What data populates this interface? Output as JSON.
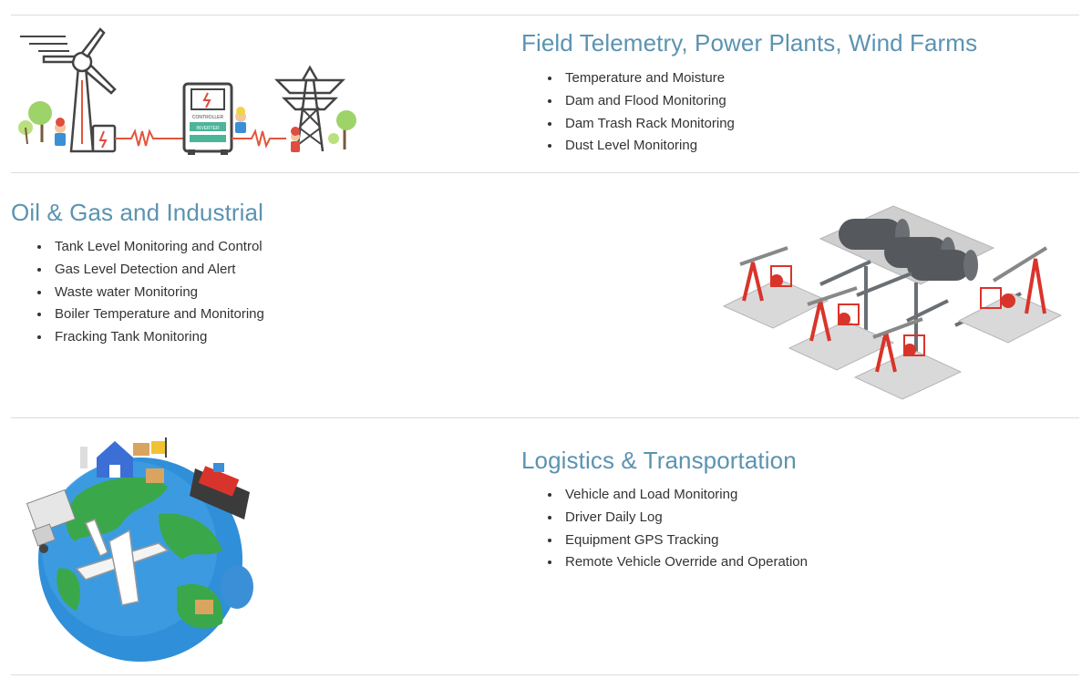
{
  "sections": [
    {
      "title": "Field Telemetry, Power Plants, Wind Farms",
      "items": [
        "Temperature and Moisture",
        "Dam and Flood Monitoring",
        "Dam Trash Rack Monitoring",
        "Dust Level Monitoring"
      ],
      "illustration_text": {
        "controller": "CONTROLLER",
        "inverter": "INVERTER"
      },
      "illustration": "wind-turbine-inverter-power-tower"
    },
    {
      "title": "Oil & Gas and Industrial",
      "items": [
        "Tank Level Monitoring and Control",
        "Gas Level Detection and Alert",
        "Waste water Monitoring",
        "Boiler Temperature and Monitoring",
        "Fracking Tank Monitoring"
      ],
      "illustration": "oil-pump-jacks-and-storage-tanks"
    },
    {
      "title": "Logistics & Transportation",
      "items": [
        "Vehicle and Load Monitoring",
        "Driver Daily Log",
        "Equipment GPS Tracking",
        "Remote Vehicle Override and Operation"
      ],
      "illustration": "globe-with-airplane-ship-truck"
    }
  ],
  "colors": {
    "heading": "#5b93b1",
    "text": "#333333",
    "divider": "#dcdcdc",
    "accent_red": "#d9342b",
    "globe_blue": "#2f8fd8",
    "globe_green": "#3aa84a"
  }
}
